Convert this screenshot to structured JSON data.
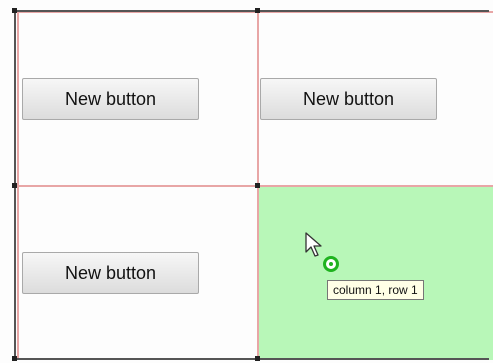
{
  "grid": {
    "cells": [
      {
        "column": 0,
        "row": 0,
        "button_label": "New button"
      },
      {
        "column": 1,
        "row": 0,
        "button_label": "New button"
      },
      {
        "column": 0,
        "row": 1,
        "button_label": "New button"
      },
      {
        "column": 1,
        "row": 1,
        "button_label": ""
      }
    ],
    "highlight_color": "#b8f7b8",
    "gridline_color": "#e8a6a6"
  },
  "drag": {
    "pointer_icon": "arrow-pointer-icon",
    "drop_icon": "green-circle-drop-icon",
    "tooltip": "column 1, row 1"
  }
}
